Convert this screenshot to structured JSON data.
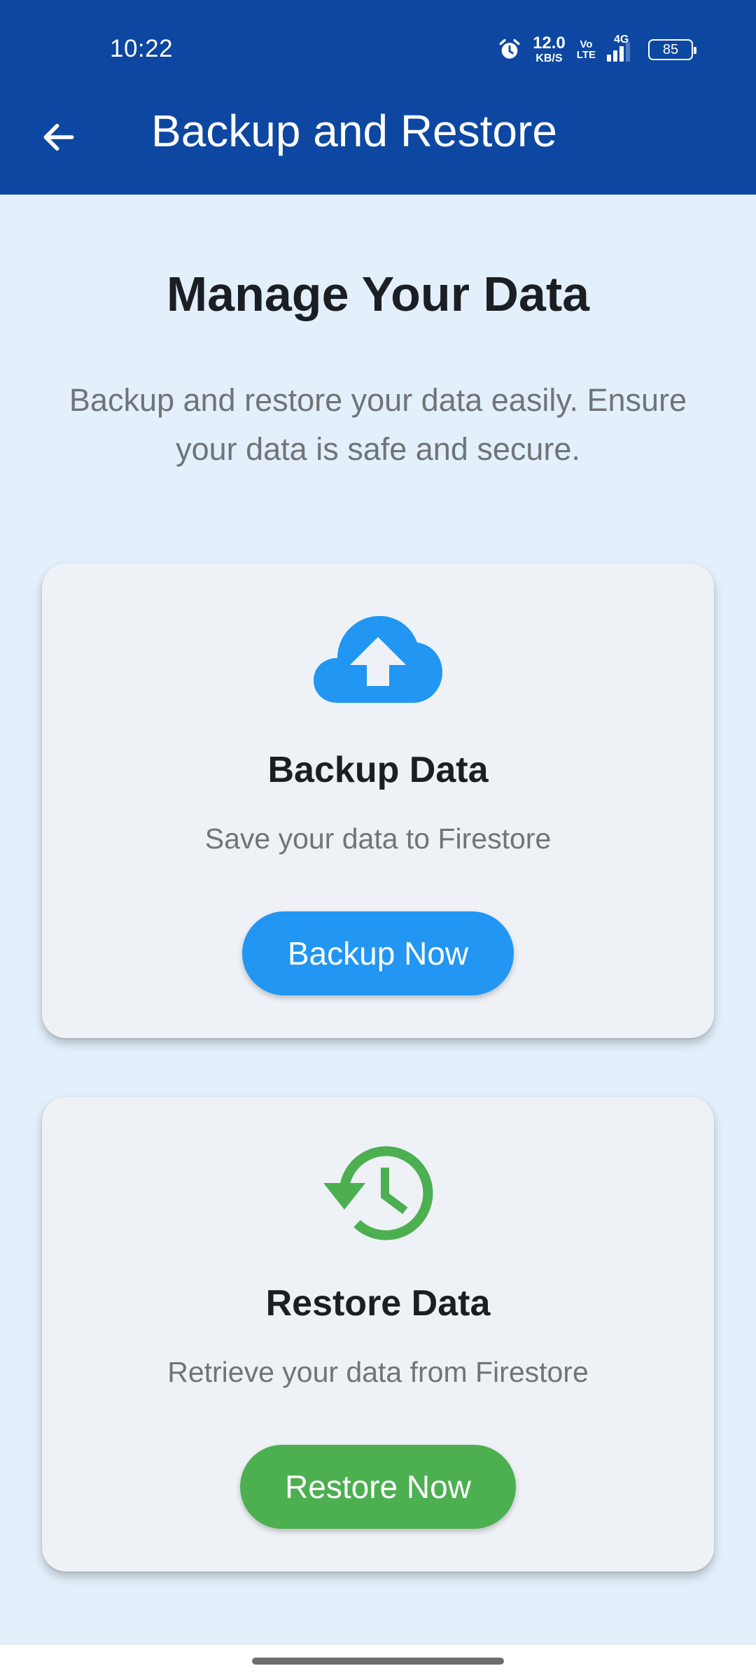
{
  "status_bar": {
    "time": "10:22",
    "net_speed_value": "12.0",
    "net_speed_unit": "KB/S",
    "volte_top": "Vo",
    "volte_bottom": "LTE",
    "network_type": "4G",
    "battery_level": "85",
    "icons": [
      "alarm-icon",
      "signal-icon",
      "battery-icon"
    ]
  },
  "app_bar": {
    "title": "Backup and Restore",
    "back_icon": "arrow-left-icon",
    "background_color": "#0d47a1"
  },
  "main": {
    "heading": "Manage Your Data",
    "subtitle": "Backup and restore your data easily. Ensure your data is safe and secure."
  },
  "cards": {
    "backup": {
      "icon": "cloud-upload-icon",
      "icon_color": "#2196f3",
      "title": "Backup Data",
      "description": "Save your data to Firestore",
      "button_label": "Backup Now",
      "button_color": "#2196f3"
    },
    "restore": {
      "icon": "restore-history-icon",
      "icon_color": "#4caf50",
      "title": "Restore Data",
      "description": "Retrieve your data from Firestore",
      "button_label": "Restore Now",
      "button_color": "#4caf50"
    }
  },
  "colors": {
    "background": "#e3f0fb",
    "card_background": "#eef2f7"
  }
}
